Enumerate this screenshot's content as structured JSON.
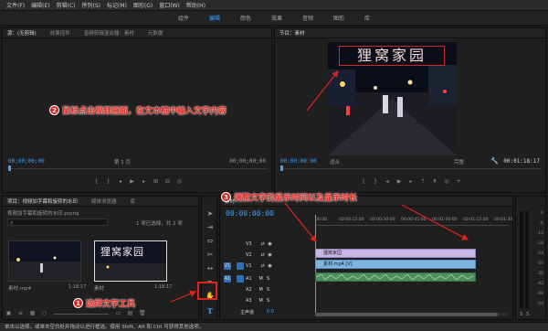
{
  "menu": [
    "文件(F)",
    "编辑(E)",
    "剪辑(C)",
    "序列(S)",
    "标记(M)",
    "图形(G)",
    "窗口(W)",
    "帮助(H)"
  ],
  "workspaces": [
    "组件",
    "编辑",
    "颜色",
    "效果",
    "音频",
    "图形",
    "库"
  ],
  "source_panel": {
    "tabs": [
      "源：(无剪辑)",
      "效果控件",
      "音频剪辑混合器：素材",
      "元数据"
    ],
    "timecode_left": "00;00;00;00",
    "page": "第 1 页",
    "timecode_right": "00;00;00;00"
  },
  "program_panel": {
    "title": "节目：素材",
    "timecode_left": "00:00:00:00",
    "fit": "适合",
    "quality": "完整",
    "timecode_right": "00:01:18:17",
    "video_title_text": "狸窝家园"
  },
  "project_panel": {
    "tabs": [
      "项目：视频加字幕和旋转的水印",
      "媒体浏览器",
      "库"
    ],
    "file": "视频加字幕和旋转的水印.prproj",
    "selection": "1 项已选择，共 2 项",
    "items": [
      {
        "name": "素材.mp4",
        "duration": "1:18:17"
      },
      {
        "name": "素材",
        "duration": "1:18:17",
        "title_text": "狸窝家园"
      }
    ]
  },
  "timeline": {
    "tab": "素材",
    "timecode": "00:00:00:00",
    "ruler": [
      "00:00",
      "00:00:15:00",
      "00:00:30:00",
      "00:00:45:00",
      "00:01:00:00",
      "00:01:15:00",
      "00:01:30"
    ],
    "video_tracks": [
      "V3",
      "V2",
      "V1"
    ],
    "audio_tracks": [
      "A1",
      "A2",
      "A3"
    ],
    "master": "主声道",
    "master_value": "0.0",
    "clips": {
      "title_clip": "狸窝家园",
      "video_clip": "素材.mp4 [V]"
    }
  },
  "meter": {
    "ticks": [
      "0",
      "-6",
      "-12",
      "-18",
      "-24",
      "-30",
      "-36",
      "-42",
      "-48",
      "-54"
    ],
    "footer": [
      "S",
      "S"
    ]
  },
  "annotations": [
    {
      "num": "1",
      "text": "选择文字工具"
    },
    {
      "num": "2",
      "text": "鼠标点击视频画面，在文本框中输入文字内容"
    },
    {
      "num": "3",
      "text": "调整文字的显示时间以及显示时长"
    }
  ],
  "status_bar": "单击以选择，或单击空白处并拖动以进行框选。使用 Shift、Alt 和 Ctrl 可获得其他选项。",
  "colors": {
    "accent": "#3ea0ff",
    "annotation": "#e0231a",
    "title_clip": "#c7b7e5",
    "video_clip": "#7fb3e0"
  }
}
